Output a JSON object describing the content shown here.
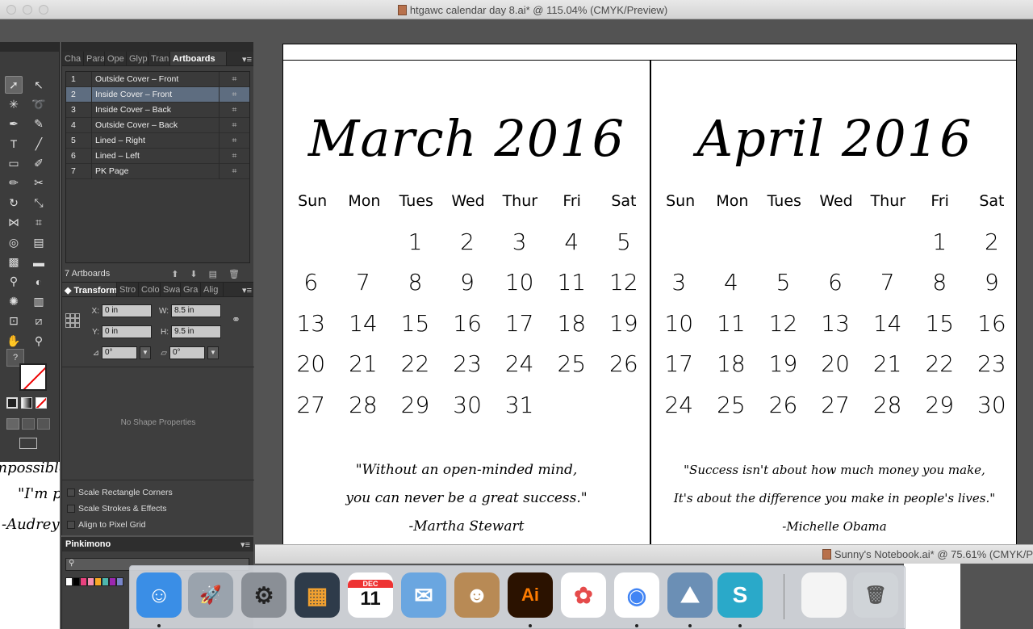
{
  "window": {
    "title": "htgawc calendar day 8.ai* @ 115.04% (CMYK/Preview)"
  },
  "second_window": {
    "title": "Sunny's Notebook.ai* @ 75.61% (CMYK/P"
  },
  "artboards_panel": {
    "tabs": [
      "Cha",
      "Para",
      "Ope",
      "Glyp",
      "Tran",
      "Artboards"
    ],
    "active_tab": "Artboards",
    "rows": [
      {
        "num": "1",
        "name": "Outside Cover – Front"
      },
      {
        "num": "2",
        "name": "Inside Cover – Front"
      },
      {
        "num": "3",
        "name": "Inside Cover – Back"
      },
      {
        "num": "4",
        "name": "Outside Cover – Back"
      },
      {
        "num": "5",
        "name": "Lined – Right"
      },
      {
        "num": "6",
        "name": "Lined  – Left"
      },
      {
        "num": "7",
        "name": "PK Page"
      }
    ],
    "selected_index": 1,
    "count_label": "7 Artboards"
  },
  "transform_panel": {
    "tabs": [
      "Transform",
      "Stro",
      "Colo",
      "Swa",
      "Gra",
      "Alig"
    ],
    "x_label": "X:",
    "x_value": "0 in",
    "y_label": "Y:",
    "y_value": "0 in",
    "w_label": "W:",
    "w_value": "8.5 in",
    "h_label": "H:",
    "h_value": "9.5 in",
    "angle_value": "0°",
    "shear_value": "0°",
    "no_shape": "No Shape Properties",
    "options": [
      "Scale Rectangle Corners",
      "Scale Strokes & Effects",
      "Align to Pixel Grid"
    ]
  },
  "swatches_panel": {
    "title": "Pinkimono",
    "colors": [
      "#ffffff",
      "#000000",
      "#e8417e",
      "#f48fb1",
      "#f9a825",
      "#4db6ac",
      "#9c27b0",
      "#7986cb"
    ]
  },
  "behind_doc": {
    "line1": "mpossible,",
    "line2": "\"I'm p",
    "line3": "-Audrey"
  },
  "calendar": {
    "weekdays": [
      "Sun",
      "Mon",
      "Tues",
      "Wed",
      "Thur",
      "Fri",
      "Sat"
    ],
    "months": [
      {
        "title": "March 2016",
        "days": [
          "",
          "",
          "1",
          "2",
          "3",
          "4",
          "5",
          "6",
          "7",
          "8",
          "9",
          "10",
          "11",
          "12",
          "13",
          "14",
          "15",
          "16",
          "17",
          "18",
          "19",
          "20",
          "21",
          "22",
          "23",
          "24",
          "25",
          "26",
          "27",
          "28",
          "29",
          "30",
          "31",
          "",
          ""
        ],
        "quote_line1": "\"Without an open-minded mind,",
        "quote_line2": "you can never be a great success.\"",
        "quote_author": "-Martha Stewart"
      },
      {
        "title": "April 2016",
        "days": [
          "",
          "",
          "",
          "",
          "",
          "1",
          "2",
          "3",
          "4",
          "5",
          "6",
          "7",
          "8",
          "9",
          "10",
          "11",
          "12",
          "13",
          "14",
          "15",
          "16",
          "17",
          "18",
          "19",
          "20",
          "21",
          "22",
          "23",
          "24",
          "25",
          "26",
          "27",
          "28",
          "29",
          "30"
        ],
        "quote_line1": "\"Success isn't about how much money you make,",
        "quote_line2": "It's about the difference you make in people's lives.\"",
        "quote_author": "-Michelle Obama"
      }
    ]
  },
  "dock": {
    "items": [
      {
        "name": "finder-icon",
        "label": "☺",
        "bg": "#3a8ee6",
        "fg": "#ffffff",
        "running": true
      },
      {
        "name": "launchpad-icon",
        "label": "🚀",
        "bg": "#9aa3ad",
        "fg": "#ffffff",
        "running": false
      },
      {
        "name": "system-preferences-icon",
        "label": "⚙",
        "bg": "#8a8f96",
        "fg": "#222222",
        "running": false
      },
      {
        "name": "mission-control-icon",
        "label": "▦",
        "bg": "#2e3b4a",
        "fg": "#f0a030",
        "running": false
      },
      {
        "name": "calendar-app-icon",
        "label": "11",
        "bg": "#ffffff",
        "fg": "#111111",
        "running": false
      },
      {
        "name": "mail-icon",
        "label": "✉",
        "bg": "#6aa6e0",
        "fg": "#ffffff",
        "running": false
      },
      {
        "name": "contacts-icon",
        "label": "☻",
        "bg": "#b88a55",
        "fg": "#ffffff",
        "running": false
      },
      {
        "name": "illustrator-icon",
        "label": "Ai",
        "bg": "#2b1200",
        "fg": "#ff7c00",
        "running": true
      },
      {
        "name": "photos-icon",
        "label": "✿",
        "bg": "#ffffff",
        "fg": "#e54b4b",
        "running": false
      },
      {
        "name": "chrome-icon",
        "label": "◉",
        "bg": "#ffffff",
        "fg": "#4285f4",
        "running": true
      },
      {
        "name": "preview-icon",
        "label": "⛰",
        "bg": "#6b8fb5",
        "fg": "#ffffff",
        "running": true
      },
      {
        "name": "silhouette-studio-icon",
        "label": "S",
        "bg": "#2aa9c9",
        "fg": "#ffffff",
        "running": true
      },
      {
        "name": "document-icon",
        "label": "",
        "bg": "#f4f4f4",
        "fg": "#999999",
        "running": false
      },
      {
        "name": "trash-icon",
        "label": "🗑",
        "bg": "#d0d4d8",
        "fg": "#555555",
        "running": false
      }
    ],
    "calendar_month": "DEC"
  }
}
